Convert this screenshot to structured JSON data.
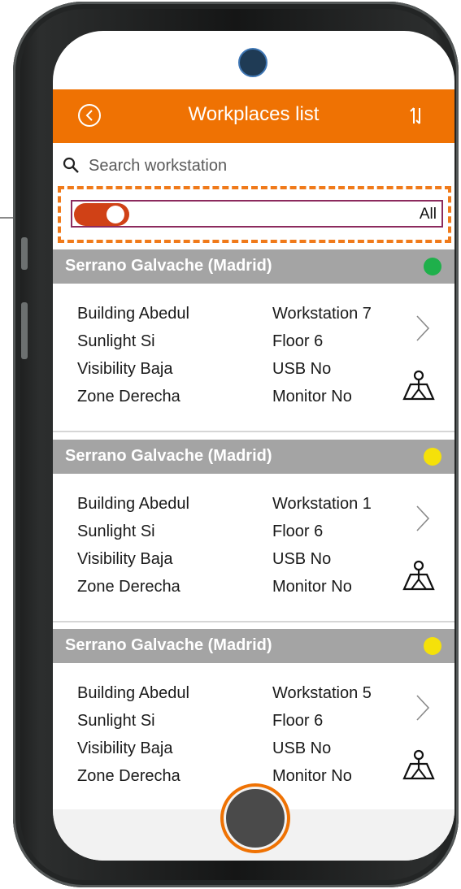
{
  "header": {
    "title": "Workplaces list"
  },
  "search": {
    "placeholder": "Search workstation"
  },
  "filter": {
    "label": "All",
    "toggle_on": true
  },
  "cards": [
    {
      "title": "Serrano Galvache (Madrid)",
      "status_color": "#1fb04b",
      "left": [
        "Building Abedul",
        "Sunlight Si",
        "Visibility Baja",
        "Zone Derecha"
      ],
      "right": [
        "Workstation 7",
        "Floor 6",
        "USB No",
        "Monitor No"
      ]
    },
    {
      "title": "Serrano Galvache (Madrid)",
      "status_color": "#f5e10a",
      "left": [
        "Building Abedul",
        "Sunlight Si",
        "Visibility Baja",
        "Zone Derecha"
      ],
      "right": [
        "Workstation 1",
        "Floor 6",
        "USB No",
        "Monitor No"
      ]
    },
    {
      "title": "Serrano Galvache (Madrid)",
      "status_color": "#f5e10a",
      "left": [
        "Building Abedul",
        "Sunlight Si",
        "Visibility Baja",
        "Zone Derecha"
      ],
      "right": [
        "Workstation 5",
        "Floor 6",
        "USB No",
        "Monitor No"
      ]
    }
  ],
  "icons": {
    "back": "back-circle-icon",
    "sort": "sort-arrows-icon",
    "search": "search-icon",
    "chevron": "chevron-right-icon",
    "map": "map-pin-icon"
  },
  "colors": {
    "accent": "#ef7203",
    "header_band": "#a4a4a4",
    "toggle": "#d04116",
    "filter_border": "#8c2a5d"
  }
}
